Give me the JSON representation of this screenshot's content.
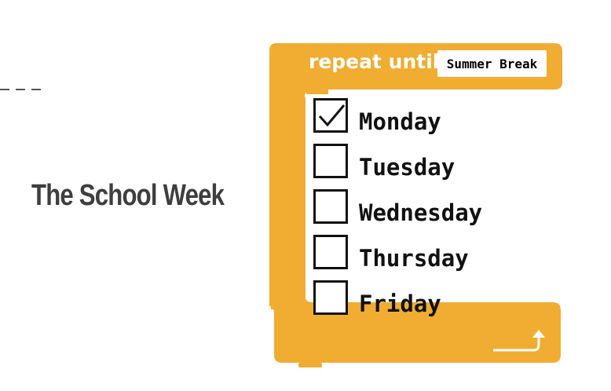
{
  "title": "The School Week",
  "block": {
    "label": "repeat until",
    "condition": "Summer Break",
    "color": "#f0ad32",
    "loop_icon": "loop-arrow-icon"
  },
  "days": [
    {
      "label": "Monday",
      "checked": true
    },
    {
      "label": "Tuesday",
      "checked": false
    },
    {
      "label": "Wednesday",
      "checked": false
    },
    {
      "label": "Thursday",
      "checked": false
    },
    {
      "label": "Friday",
      "checked": false
    }
  ]
}
